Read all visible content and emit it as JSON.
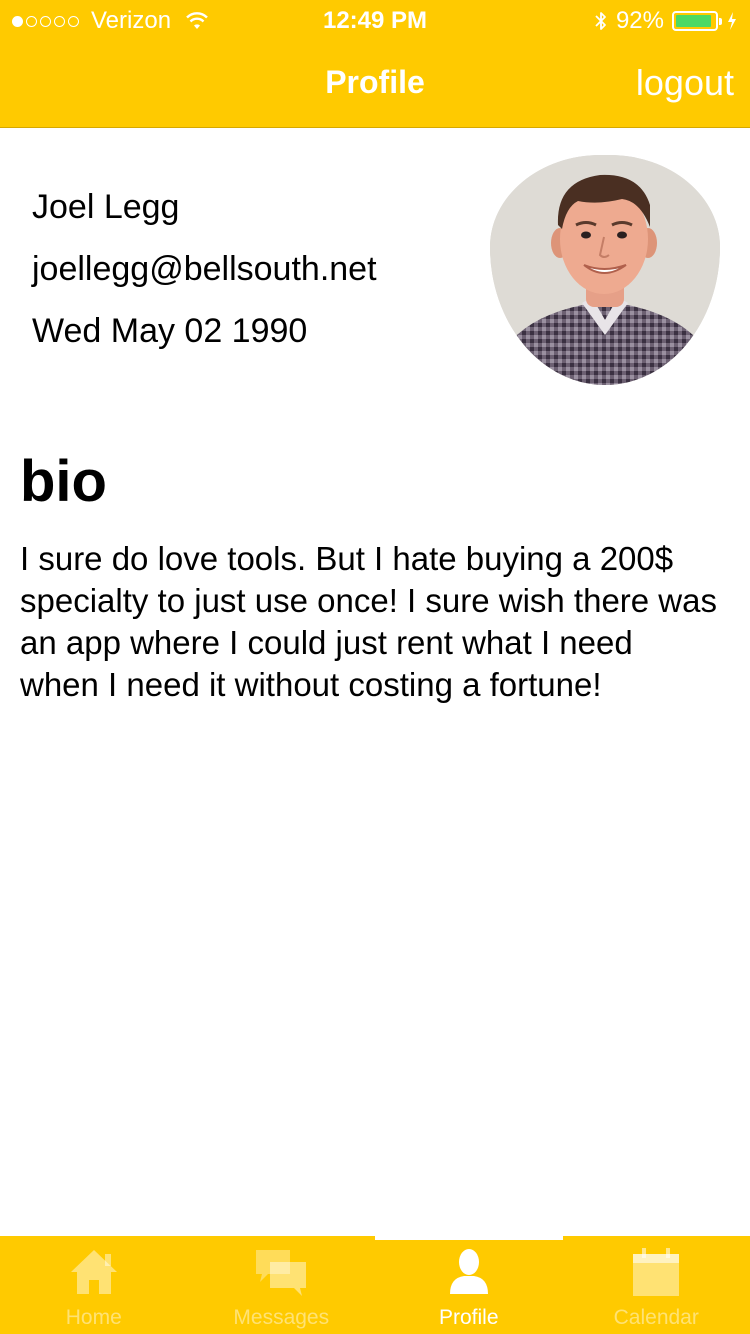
{
  "status_bar": {
    "carrier": "Verizon",
    "time": "12:49 PM",
    "battery_text": "92%",
    "battery_level": 0.92,
    "signal_bars": 1
  },
  "nav": {
    "title": "Profile",
    "logout_label": "logout"
  },
  "profile": {
    "name": "Joel Legg",
    "email": "joellegg@bellsouth.net",
    "birthdate": "Wed May 02 1990"
  },
  "bio": {
    "heading": "bio",
    "text": "I sure do love tools. But I hate buying a 200$ specialty to just use once! I sure wish there was an app where I could just rent what I need when I need it without costing a fortune!"
  },
  "tabs": [
    {
      "label": "Home",
      "icon": "home-icon",
      "active": false
    },
    {
      "label": "Messages",
      "icon": "messages-icon",
      "active": false
    },
    {
      "label": "Profile",
      "icon": "profile-icon",
      "active": true
    },
    {
      "label": "Calendar",
      "icon": "calendar-icon",
      "active": false
    }
  ],
  "colors": {
    "accent": "#FFCA00",
    "battery_fill": "#4cd964",
    "text": "#000000"
  }
}
